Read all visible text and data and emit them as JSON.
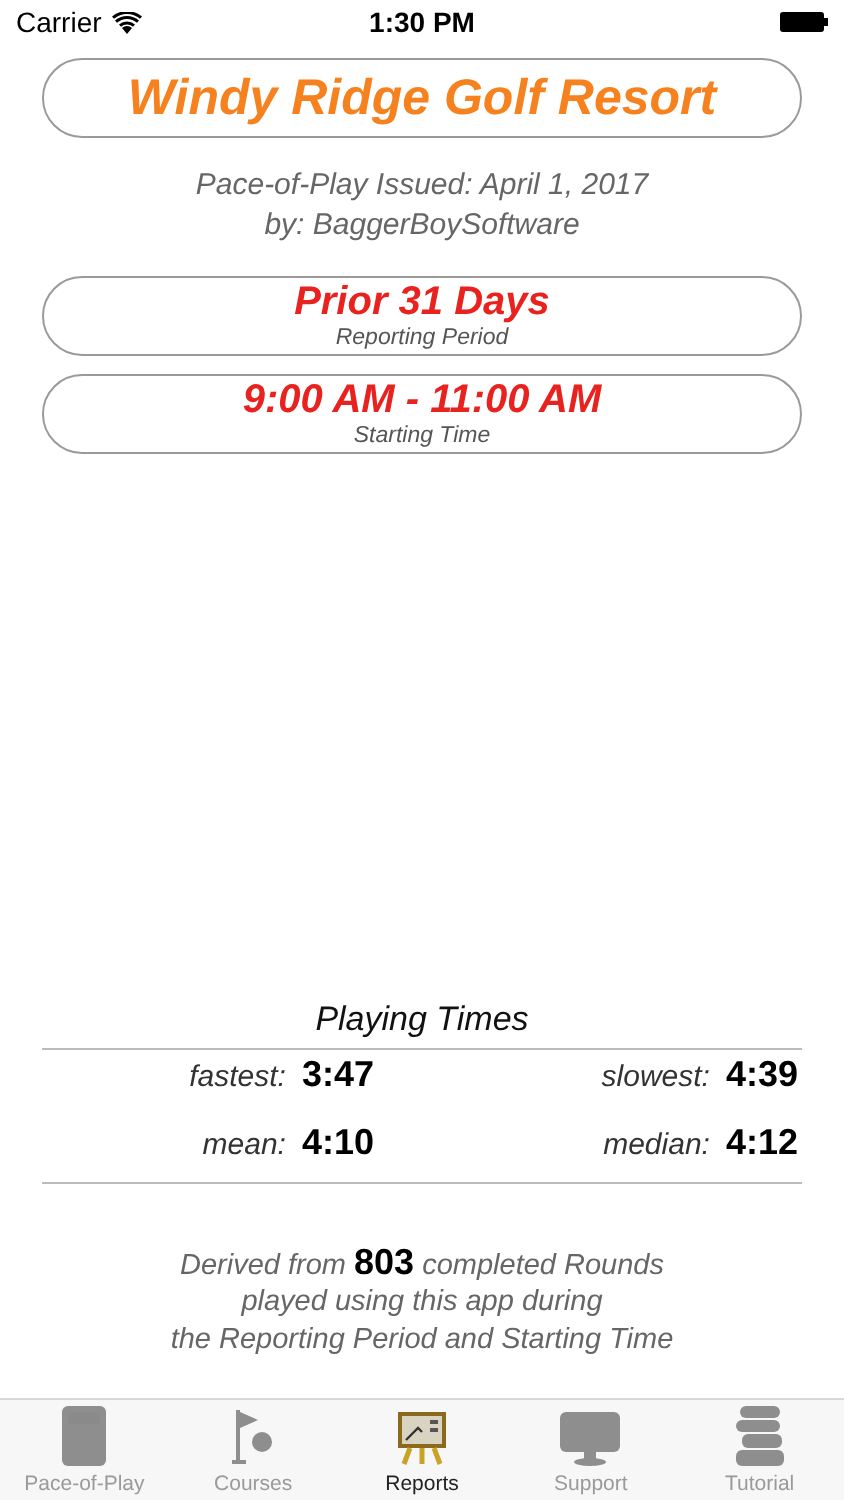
{
  "status_bar": {
    "carrier": "Carrier",
    "time": "1:30 PM"
  },
  "title": "Windy Ridge Golf Resort",
  "issued": "Pace-of-Play Issued: April 1, 2017",
  "author": "by: BaggerBoySoftware",
  "filters": [
    {
      "value": "Prior 31 Days",
      "caption": "Reporting Period"
    },
    {
      "value": "9:00 AM - 11:00 AM",
      "caption": "Starting Time"
    }
  ],
  "playing_times": {
    "heading": "Playing Times",
    "stats": [
      {
        "label": "fastest:",
        "value": "3:47"
      },
      {
        "label": "slowest:",
        "value": "4:39"
      },
      {
        "label": "mean:",
        "value": "4:10"
      },
      {
        "label": "median:",
        "value": "4:12"
      }
    ]
  },
  "note": "Derived from  **803**  completed Rounds\nplayed using this app during\nthe Reporting Period and Starting Time",
  "tabs": [
    {
      "label": "Pace-of-Play",
      "kind": "calculator",
      "selected": false
    },
    {
      "label": "Courses",
      "kind": "flag",
      "selected": false
    },
    {
      "label": "Reports",
      "kind": "easel",
      "selected": true
    },
    {
      "label": "Support",
      "kind": "monitor",
      "selected": false
    },
    {
      "label": "Tutorial",
      "kind": "books",
      "selected": false
    }
  ]
}
